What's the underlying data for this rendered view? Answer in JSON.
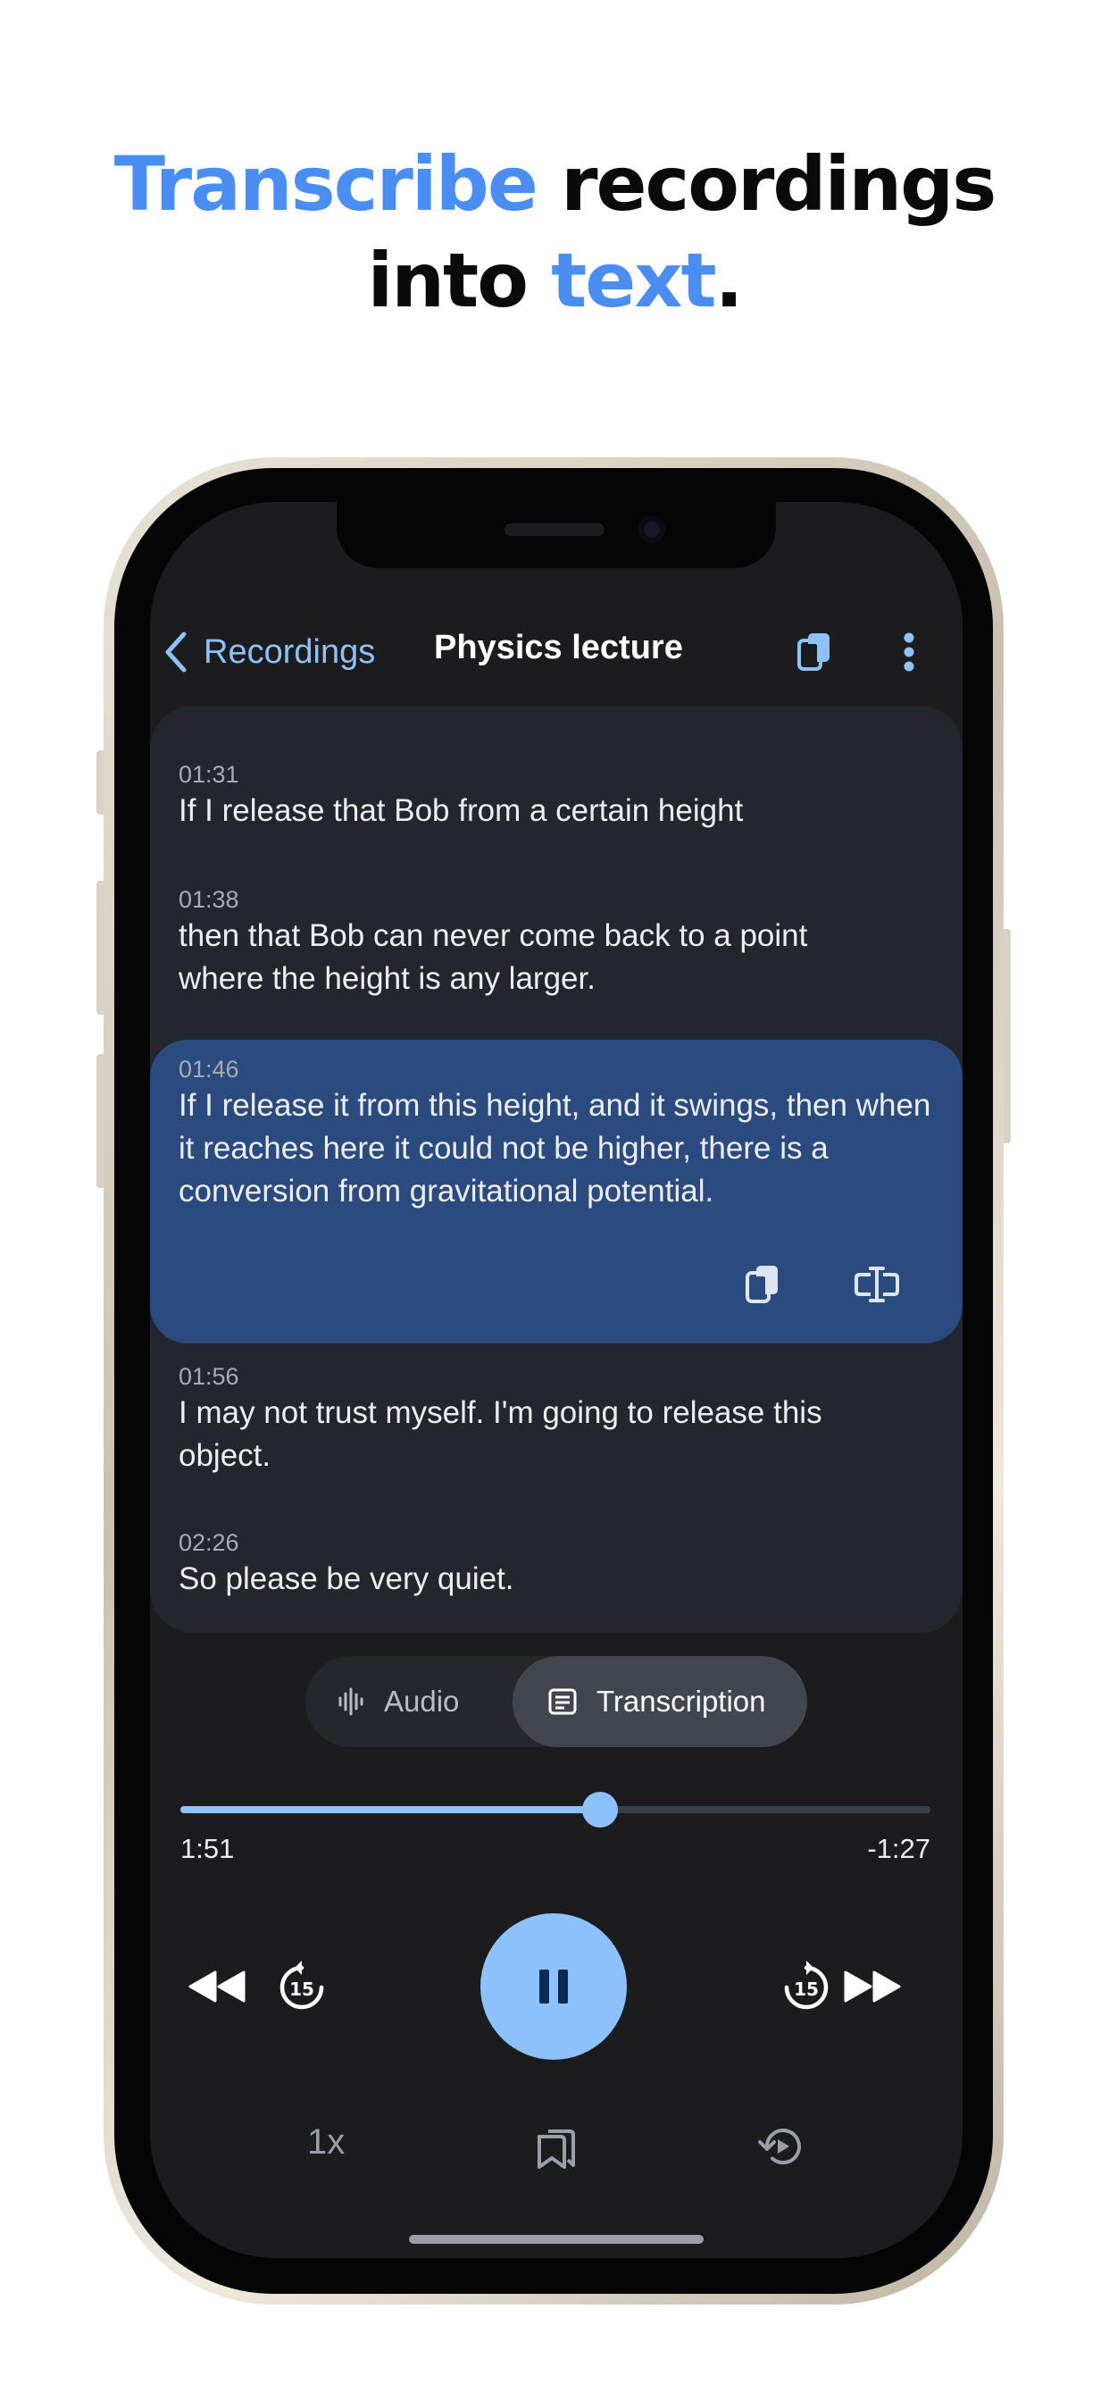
{
  "headline": {
    "accent_word_1": "Transcribe",
    "plain_1": " recordings",
    "plain_2": "into ",
    "accent_word_2": "text",
    "period": "."
  },
  "colors": {
    "accent": "#4a8ef3",
    "app_accent": "#8ec2ff",
    "screen_bg": "#1c1c1e",
    "card_bg": "#23262d",
    "highlight_bg": "#2b4a7e"
  },
  "nav": {
    "back_label": "Recordings",
    "title": "Physics lecture",
    "icons": [
      "chevron-left-icon",
      "copy-icon",
      "more-vertical-icon"
    ]
  },
  "segments": [
    {
      "time": "01:31",
      "text": "If I release that Bob from a certain height"
    },
    {
      "time": "01:38",
      "text": "then that Bob can never come back to a point where the height is any larger."
    },
    {
      "time": "01:46",
      "text": "If I release it from this height, and it swings, then when it reaches here it could not be higher, there is a conversion from gravitational potential.",
      "active": true
    },
    {
      "time": "01:56",
      "text": "I may not trust myself. I'm going to release this object."
    },
    {
      "time": "02:26",
      "text": "So please be very quiet."
    }
  ],
  "segment_actions": [
    "copy-icon",
    "text-cursor-icon"
  ],
  "view_toggle": {
    "audio_label": "Audio",
    "transcription_label": "Transcription",
    "selected": "Transcription"
  },
  "player": {
    "elapsed": "1:51",
    "remaining": "-1:27",
    "progress": 0.56,
    "state": "playing",
    "speed": "1x",
    "skip_back_seconds": "15",
    "skip_forward_seconds": "15"
  }
}
